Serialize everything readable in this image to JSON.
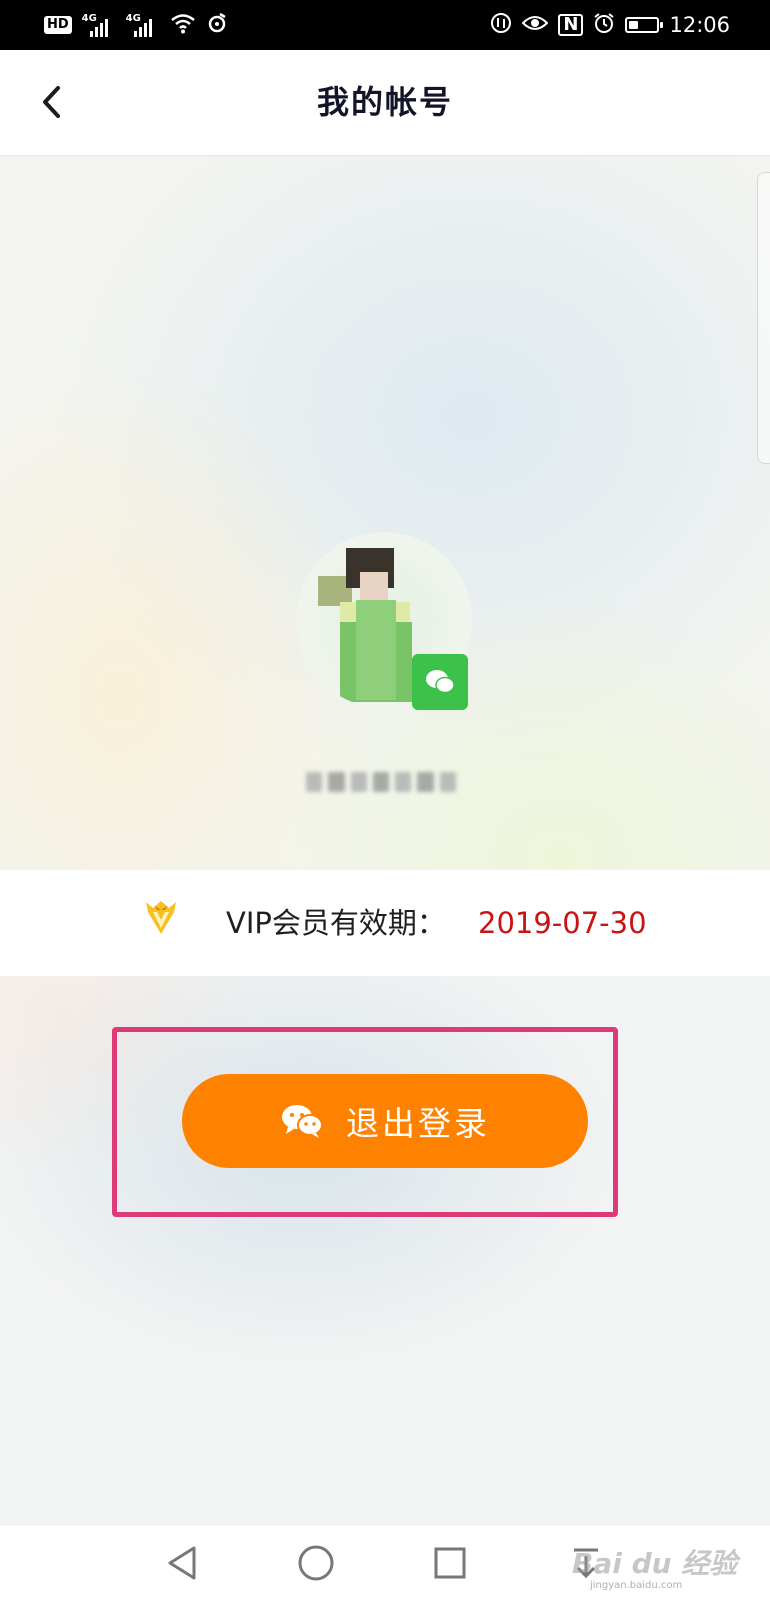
{
  "status_bar": {
    "hd": "HD",
    "sim1": "4G",
    "sim2": "4G",
    "nfc": "N",
    "time": "12:06",
    "battery_level": 0.35
  },
  "header": {
    "title": "我的帐号"
  },
  "vip": {
    "label": "VIP会员有效期：",
    "expiry_date": "2019-07-30"
  },
  "logout": {
    "label": "退出登录"
  },
  "watermark": {
    "text": "Bai du 经验",
    "sub": "jingyan.baidu.com"
  },
  "colors": {
    "accent_orange": "#ff8100",
    "highlight_border": "#dc3a78",
    "date_red": "#c81414",
    "wechat_green": "#3cc24b"
  },
  "icons": {
    "back": "chevron-left-icon",
    "vip": "vip-crown-icon",
    "wechat": "wechat-icon",
    "nav_back": "triangle-back-icon",
    "nav_home": "circle-home-icon",
    "nav_recent": "square-recent-icon"
  }
}
